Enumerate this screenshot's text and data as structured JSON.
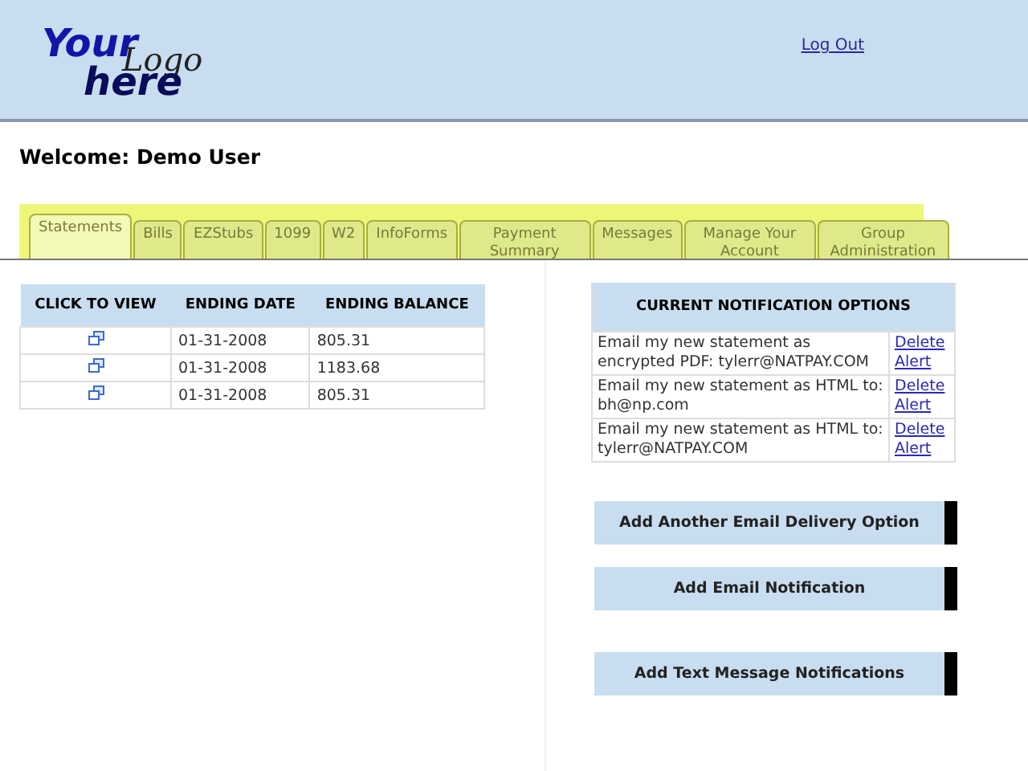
{
  "header": {
    "logo": {
      "your": "Your",
      "logo": "Logo",
      "here": "here"
    },
    "logout": "Log Out"
  },
  "welcome": "Welcome: Demo User",
  "tabs": [
    {
      "label": "Statements",
      "selected": true
    },
    {
      "label": "Bills",
      "selected": false
    },
    {
      "label": "EZStubs",
      "selected": false
    },
    {
      "label": "1099",
      "selected": false
    },
    {
      "label": "W2",
      "selected": false
    },
    {
      "label": "InfoForms",
      "selected": false
    },
    {
      "label": "Payment Summary",
      "selected": false
    },
    {
      "label": "Messages",
      "selected": false
    },
    {
      "label": "Manage Your Account",
      "selected": false
    },
    {
      "label": "Group Administration",
      "selected": false
    }
  ],
  "statements": {
    "columns": [
      "CLICK TO VIEW",
      "ENDING DATE",
      "ENDING BALANCE"
    ],
    "rows": [
      {
        "date": "01-31-2008",
        "balance": "805.31"
      },
      {
        "date": "01-31-2008",
        "balance": "1183.68"
      },
      {
        "date": "01-31-2008",
        "balance": "805.31"
      }
    ]
  },
  "notifications": {
    "title": "CURRENT NOTIFICATION OPTIONS",
    "rows": [
      {
        "text": "Email my new statement as encrypted PDF: tylerr@NATPAY.COM",
        "action": "Delete Alert"
      },
      {
        "text": "Email my new statement as HTML to: bh@np.com",
        "action": "Delete Alert"
      },
      {
        "text": "Email my new statement as HTML to: tylerr@NATPAY.COM",
        "action": "Delete Alert"
      }
    ]
  },
  "buttons": [
    "Add Another Email Delivery Option",
    "Add Email Notification",
    "Add Text Message Notifications"
  ]
}
